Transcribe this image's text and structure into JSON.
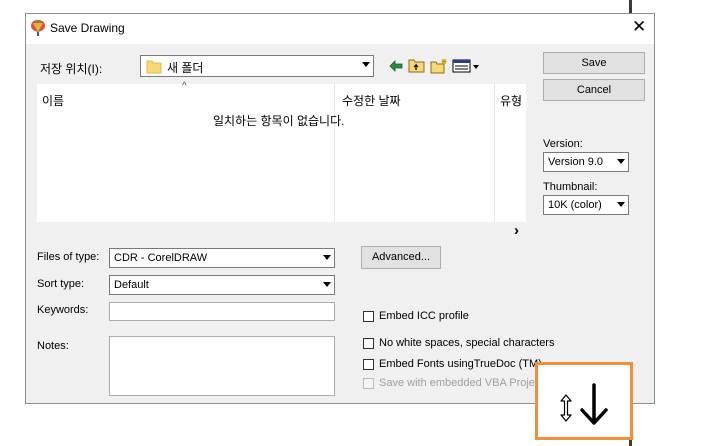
{
  "window": {
    "title": "Save Drawing",
    "close_glyph": "✕"
  },
  "location": {
    "label": "저장 위치(I):",
    "folder": "새 폴더"
  },
  "file_list": {
    "columns": [
      "이름",
      "수정한 날짜",
      "유형"
    ],
    "empty_message": "일치하는 항목이 없습니다.",
    "scroll_glyph": "›"
  },
  "buttons": {
    "save": "Save",
    "cancel": "Cancel",
    "advanced": "Advanced..."
  },
  "version": {
    "label": "Version:",
    "value": "Version 9.0"
  },
  "thumbnail": {
    "label": "Thumbnail:",
    "value": "10K (color)"
  },
  "fields": {
    "files_of_type_label": "Files of type:",
    "files_of_type_value": "CDR - CorelDRAW",
    "sort_type_label": "Sort type:",
    "sort_type_value": "Default",
    "keywords_label": "Keywords:",
    "notes_label": "Notes:"
  },
  "checkboxes": [
    {
      "label": "Embed ICC profile",
      "checked": false,
      "enabled": true
    },
    {
      "label": "No white spaces, special characters",
      "checked": false,
      "enabled": true
    },
    {
      "label": "Embed Fonts usingTrueDoc (TM)",
      "checked": false,
      "enabled": true
    },
    {
      "label": "Save with embedded VBA Project",
      "checked": false,
      "enabled": false
    }
  ],
  "colors": {
    "accent_orange": "#f39035",
    "dialog_bg": "#f0f0f0",
    "button_bg": "#e1e1e1",
    "folder_yellow": "#f8d775"
  },
  "icons": [
    "coreldraw-logo-icon",
    "folder-icon",
    "back-arrow-icon",
    "up-folder-icon",
    "new-folder-icon",
    "view-menu-icon",
    "resize-cursor-icon",
    "down-arrow-icon"
  ]
}
